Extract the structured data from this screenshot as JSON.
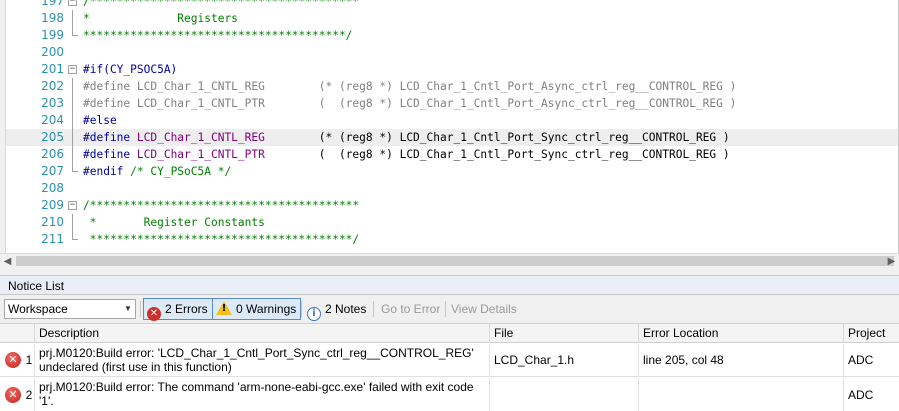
{
  "editor": {
    "lines": [
      {
        "num": "197",
        "fold": "box",
        "segs": [
          {
            "c": "c-comment",
            "t": "/****************************************"
          }
        ]
      },
      {
        "num": "198",
        "fold": "line",
        "segs": [
          {
            "c": "c-comment",
            "t": "*             Registers"
          }
        ]
      },
      {
        "num": "199",
        "fold": "end",
        "segs": [
          {
            "c": "c-comment",
            "t": "***************************************/"
          }
        ]
      },
      {
        "num": "200",
        "fold": "",
        "segs": []
      },
      {
        "num": "201",
        "fold": "box",
        "segs": [
          {
            "c": "c-pre",
            "t": "#if(CY_PSOC5A)"
          }
        ]
      },
      {
        "num": "202",
        "fold": "line",
        "segs": [
          {
            "c": "c-gray",
            "t": "#define LCD_Char_1_CNTL_REG        (* (reg8 *) LCD_Char_1_Cntl_Port_Async_ctrl_reg__CONTROL_REG )"
          }
        ]
      },
      {
        "num": "203",
        "fold": "line",
        "segs": [
          {
            "c": "c-gray",
            "t": "#define LCD_Char_1_CNTL_PTR        (  (reg8 *) LCD_Char_1_Cntl_Port_Async_ctrl_reg__CONTROL_REG )"
          }
        ]
      },
      {
        "num": "204",
        "fold": "line",
        "segs": [
          {
            "c": "c-pre",
            "t": "#else"
          }
        ]
      },
      {
        "num": "205",
        "fold": "line",
        "sel": true,
        "segs": [
          {
            "c": "c-pre",
            "t": "#define "
          },
          {
            "c": "c-macro",
            "t": "LCD_Char_1_CNTL_REG"
          },
          {
            "c": "c-plain",
            "t": "        (* (reg8 *) LCD_Char_1_Cntl_Port_Sync_ctrl_reg__CONTROL_REG )"
          }
        ]
      },
      {
        "num": "206",
        "fold": "line",
        "segs": [
          {
            "c": "c-pre",
            "t": "#define "
          },
          {
            "c": "c-macro",
            "t": "LCD_Char_1_CNTL_PTR"
          },
          {
            "c": "c-plain",
            "t": "        (  (reg8 *) LCD_Char_1_Cntl_Port_Sync_ctrl_reg__CONTROL_REG )"
          }
        ]
      },
      {
        "num": "207",
        "fold": "end",
        "segs": [
          {
            "c": "c-pre",
            "t": "#endif "
          },
          {
            "c": "c-comment",
            "t": "/* CY_PSoC5A */"
          }
        ]
      },
      {
        "num": "208",
        "fold": "",
        "segs": []
      },
      {
        "num": "209",
        "fold": "box",
        "segs": [
          {
            "c": "c-comment",
            "t": "/****************************************"
          }
        ]
      },
      {
        "num": "210",
        "fold": "line",
        "segs": [
          {
            "c": "c-comment",
            "t": " *       Register Constants"
          }
        ]
      },
      {
        "num": "211",
        "fold": "end",
        "segs": [
          {
            "c": "c-comment",
            "t": " ***************************************/"
          }
        ]
      }
    ]
  },
  "notice_list": {
    "title": "Notice List",
    "workspace_value": "Workspace",
    "errors_label": "2 Errors",
    "warnings_label": "0 Warnings",
    "notes_label": "2 Notes",
    "go_to_error_label": "Go to Error",
    "view_details_label": "View Details",
    "columns": [
      "Description",
      "File",
      "Error Location",
      "Project"
    ],
    "rows": [
      {
        "num": "1",
        "description": "prj.M0120:Build error: 'LCD_Char_1_Cntl_Port_Sync_ctrl_reg__CONTROL_REG' undeclared (first use in this function)",
        "file": "LCD_Char_1.h",
        "location": "line 205, col 48",
        "project": "ADC"
      },
      {
        "num": "2",
        "description": "prj.M0120:Build error: The command 'arm-none-eabi-gcc.exe' failed with exit code '1'.",
        "file": "",
        "location": "",
        "project": "ADC"
      }
    ]
  }
}
